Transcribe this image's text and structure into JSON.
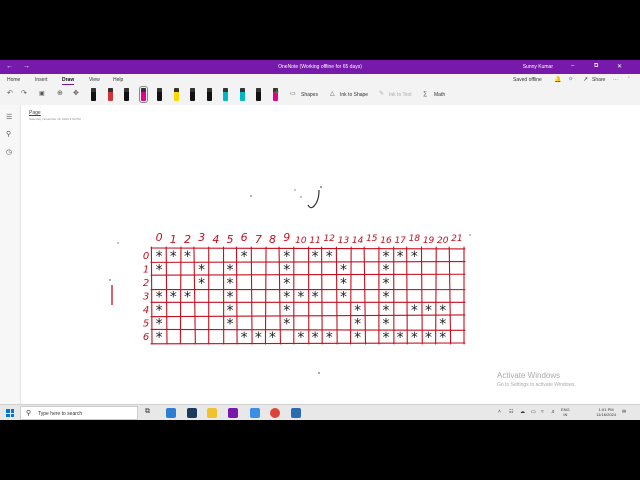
{
  "titlebar": {
    "title": "OneNote (Working offline for 65 days)",
    "user": "Sunny Kumar",
    "back_icon": "arrow-left-icon",
    "forward_icon": "arrow-right-icon",
    "minimize": "–",
    "restore": "⧉",
    "close": "✕",
    "bg_color": "#7719aa"
  },
  "tabs": {
    "items": [
      "Home",
      "Insert",
      "Draw",
      "View",
      "Help"
    ],
    "active": "Draw",
    "saved": "Saved offline",
    "share": "Share"
  },
  "ribbon": {
    "shapes": "Shapes",
    "ink_to_shape": "Ink to Shape",
    "ink_to_text": "Ink to Text",
    "math": "Math",
    "pen_colors": [
      "#111111",
      "#d13438",
      "#111111",
      "#e3008c",
      "#111111",
      "#ffd800",
      "#111111",
      "#111111",
      "#00b7c3",
      "#00b7c3",
      "#111111",
      "#e3008c"
    ]
  },
  "page": {
    "title": "Page",
    "date": "Saturday, November 16, 2024   1:00 PM"
  },
  "ink": {
    "color": "#c50f1f",
    "column_labels": [
      "0",
      "1",
      "2",
      "3",
      "4",
      "5",
      "6",
      "7",
      "8",
      "9",
      "10",
      "11",
      "12",
      "13",
      "14",
      "15",
      "16",
      "17",
      "18",
      "19",
      "20",
      "21"
    ],
    "row_labels": [
      "0",
      "1",
      "2",
      "3",
      "4",
      "5",
      "6"
    ],
    "star_glyph": "*",
    "stars": [
      [
        0,
        0
      ],
      [
        1,
        0
      ],
      [
        2,
        0
      ],
      [
        6,
        0
      ],
      [
        9,
        0
      ],
      [
        11,
        0
      ],
      [
        12,
        0
      ],
      [
        16,
        0
      ],
      [
        17,
        0
      ],
      [
        18,
        0
      ],
      [
        0,
        1
      ],
      [
        3,
        1
      ],
      [
        5,
        1
      ],
      [
        9,
        1
      ],
      [
        13,
        1
      ],
      [
        16,
        1
      ],
      [
        3,
        2
      ],
      [
        5,
        2
      ],
      [
        9,
        2
      ],
      [
        13,
        2
      ],
      [
        16,
        2
      ],
      [
        0,
        3
      ],
      [
        1,
        3
      ],
      [
        2,
        3
      ],
      [
        5,
        3
      ],
      [
        9,
        3
      ],
      [
        10,
        3
      ],
      [
        11,
        3
      ],
      [
        13,
        3
      ],
      [
        16,
        3
      ],
      [
        0,
        4
      ],
      [
        5,
        4
      ],
      [
        9,
        4
      ],
      [
        14,
        4
      ],
      [
        16,
        4
      ],
      [
        18,
        4
      ],
      [
        19,
        4
      ],
      [
        20,
        4
      ],
      [
        0,
        5
      ],
      [
        5,
        5
      ],
      [
        9,
        5
      ],
      [
        14,
        5
      ],
      [
        16,
        5
      ],
      [
        20,
        5
      ],
      [
        0,
        6
      ],
      [
        6,
        6
      ],
      [
        7,
        6
      ],
      [
        8,
        6
      ],
      [
        10,
        6
      ],
      [
        11,
        6
      ],
      [
        12,
        6
      ],
      [
        14,
        6
      ],
      [
        16,
        6
      ],
      [
        17,
        6
      ],
      [
        18,
        6
      ],
      [
        19,
        6
      ],
      [
        20,
        6
      ]
    ]
  },
  "watermark": {
    "line1": "Activate Windows",
    "line2": "Go to Settings to activate Windows."
  },
  "taskbar": {
    "search_placeholder": "Type here to search",
    "lang_line1": "ENG",
    "lang_line2": "IN",
    "time": "1:01 PM",
    "date": "11/16/2024"
  }
}
